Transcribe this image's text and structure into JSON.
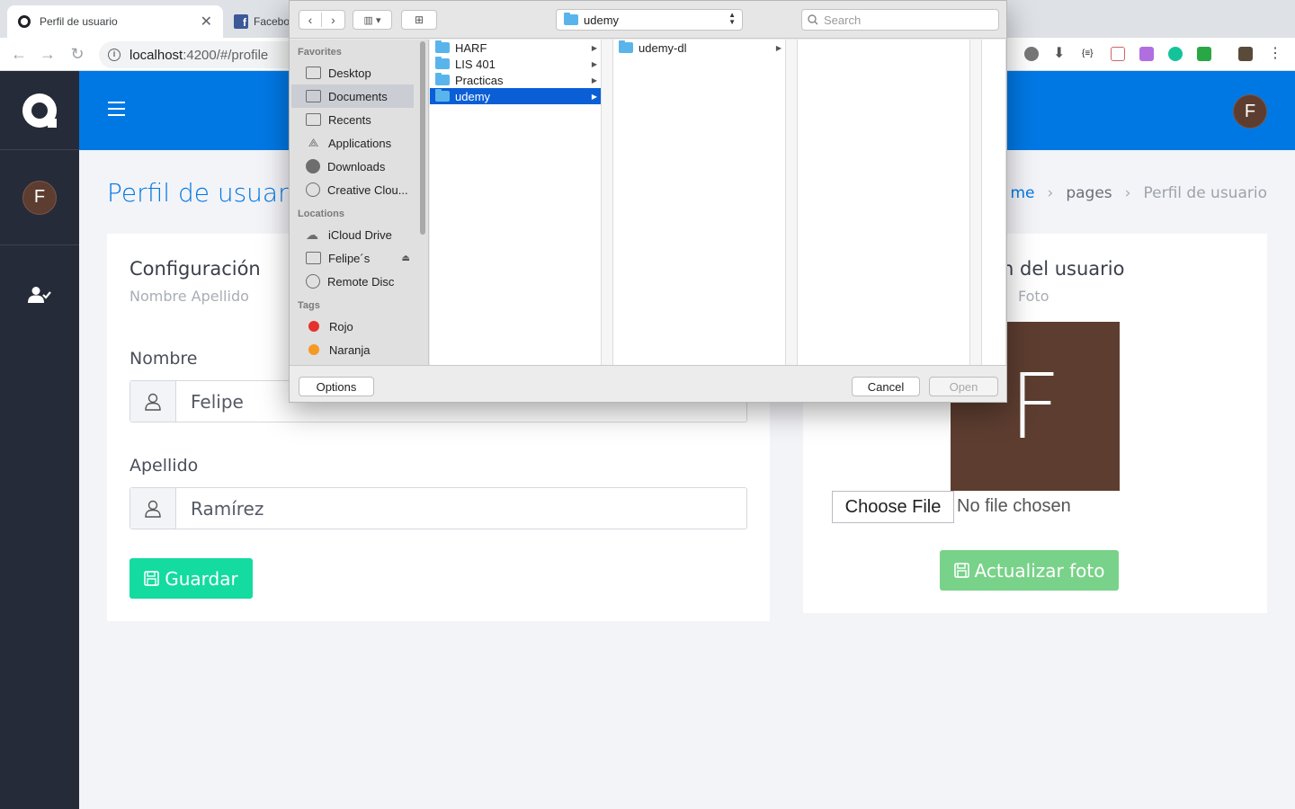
{
  "browser": {
    "active_tab_title": "Perfil de usuario",
    "inactive_tab_title": "Facebo",
    "url_host": "localhost",
    "url_rest": ":4200/#/profile"
  },
  "sidebar": {
    "avatar_letter": "F"
  },
  "topbar": {
    "avatar_letter": "F"
  },
  "page": {
    "title": "Perfil de usuario",
    "breadcrumb": [
      "me",
      "pages",
      "Perfil de usuario"
    ]
  },
  "config_card": {
    "title": "Configuración",
    "subtitle": "Nombre Apellido",
    "name_label": "Nombre",
    "name_value": "Felipe",
    "lastname_label": "Apellido",
    "lastname_value": "Ramírez",
    "save_label": "Guardar"
  },
  "photo_card": {
    "title": "n del usuario",
    "subtitle": "Foto",
    "photo_letter": "F",
    "choose_file_label": "Choose File",
    "no_file_label": "No file chosen",
    "update_label": "Actualizar foto"
  },
  "dialog": {
    "current_folder": "udemy",
    "search_placeholder": "Search",
    "favorites_header": "Favorites",
    "favorites": [
      "Desktop",
      "Documents",
      "Recents",
      "Applications",
      "Downloads",
      "Creative Clou..."
    ],
    "selected_favorite": "Documents",
    "locations_header": "Locations",
    "locations": [
      "iCloud Drive",
      "Felipe´s",
      "Remote Disc"
    ],
    "tags_header": "Tags",
    "tags": [
      {
        "name": "Rojo",
        "color": "#e5312b"
      },
      {
        "name": "Naranja",
        "color": "#f59a23"
      }
    ],
    "column1": [
      "HARF",
      "LIS 401",
      "Practicas",
      "udemy"
    ],
    "column1_selected": "udemy",
    "column2": [
      "udemy-dl"
    ],
    "options_label": "Options",
    "cancel_label": "Cancel",
    "open_label": "Open"
  },
  "colors": {
    "primary": "#0078e4",
    "sidebar": "#262b39",
    "save_button": "#14dba0",
    "update_button": "#78d289",
    "avatar": "#5d3d30"
  }
}
